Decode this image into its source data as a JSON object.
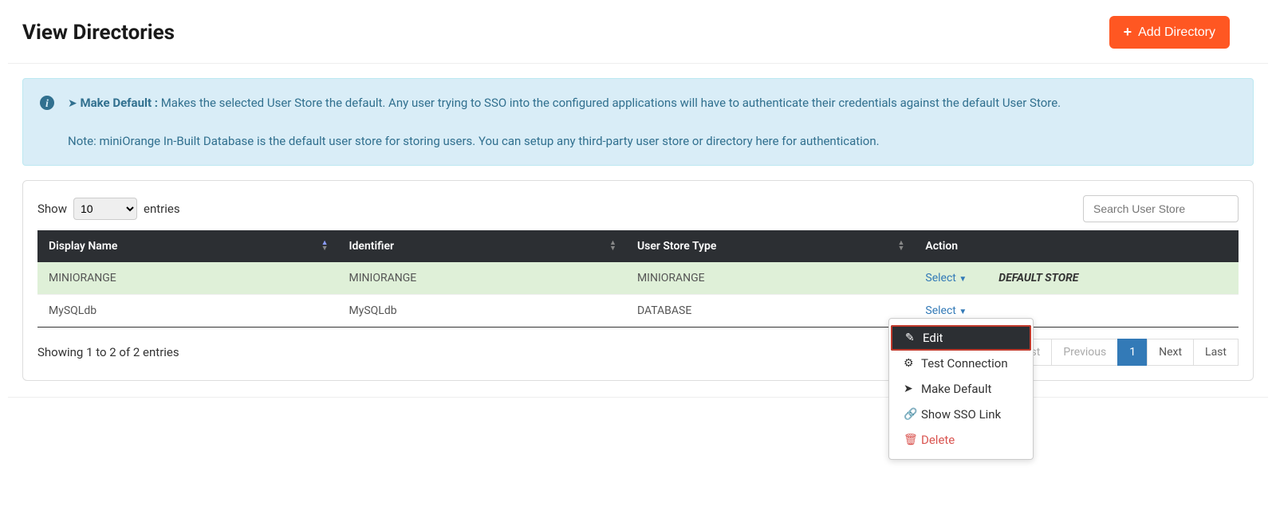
{
  "page": {
    "title": "View Directories",
    "add_button": "Add Directory"
  },
  "info": {
    "make_default_label": "Make Default :",
    "make_default_text": "Makes the selected User Store the default. Any user trying to SSO into the configured applications will have to authenticate their credentials against the default User Store.",
    "note_text": "Note: miniOrange In-Built Database is the default user store for storing users. You can setup any third-party user store or directory here for authentication."
  },
  "table": {
    "show_label": "Show",
    "entries_label": "entries",
    "show_value": "10",
    "search_placeholder": "Search User Store",
    "headers": {
      "display_name": "Display Name",
      "identifier": "Identifier",
      "type": "User Store Type",
      "action": "Action"
    },
    "rows": [
      {
        "display": "MINIORANGE",
        "identifier": "MINIORANGE",
        "type": "MINIORANGE",
        "default": true
      },
      {
        "display": "MySQLdb",
        "identifier": "MySQLdb",
        "type": "DATABASE",
        "default": false
      }
    ],
    "select_label": "Select",
    "default_badge": "DEFAULT STORE",
    "footer_info": "Showing 1 to 2 of 2 entries"
  },
  "pagination": {
    "first": "First",
    "previous": "Previous",
    "page": "1",
    "next": "Next",
    "last": "Last"
  },
  "dropdown": {
    "edit": "Edit",
    "test": "Test Connection",
    "make_default": "Make Default",
    "sso_link": "Show SSO Link",
    "delete": "Delete"
  }
}
